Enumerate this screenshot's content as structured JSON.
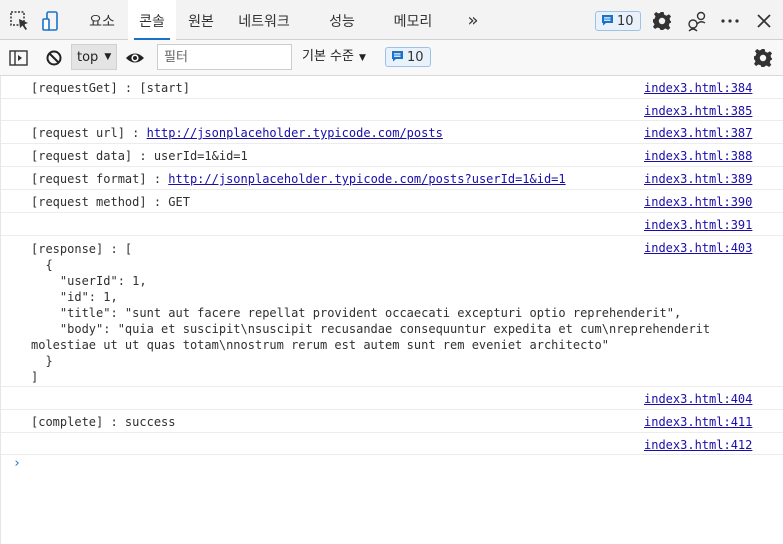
{
  "tabs": [
    {
      "label": "요소"
    },
    {
      "label": "콘솔"
    },
    {
      "label": "원본"
    },
    {
      "label": "네트워크"
    },
    {
      "label": "성능"
    },
    {
      "label": "메모리"
    }
  ],
  "active_tab": "콘솔",
  "more_tabs_label": "»",
  "message_count": "10",
  "toolbar": {
    "context": "top",
    "filter_placeholder": "필터",
    "levels_label": "기본 수준",
    "message_count": "10"
  },
  "logs": [
    {
      "message": "[requestGet] : [start]",
      "source": "index3.html:384"
    },
    {
      "message": "",
      "source": "index3.html:385"
    },
    {
      "message": "[request url] : ",
      "link": "http://jsonplaceholder.typicode.com/posts",
      "source": "index3.html:387"
    },
    {
      "message": "[request data] : userId=1&id=1",
      "source": "index3.html:388"
    },
    {
      "message": "[request format] : ",
      "link": "http://jsonplaceholder.typicode.com/posts?userId=1&id=1",
      "source": "index3.html:389"
    },
    {
      "message": "[request method] : GET",
      "source": "index3.html:390"
    },
    {
      "message": "",
      "source": "index3.html:391"
    },
    {
      "message": "[response] : [\n  {\n    \"userId\": 1,\n    \"id\": 1,\n    \"title\": \"sunt aut facere repellat provident occaecati excepturi optio reprehenderit\",\n    \"body\": \"quia et suscipit\\nsuscipit recusandae consequuntur expedita et cum\\nreprehenderit\nmolestiae ut ut quas totam\\nnostrum rerum est autem sunt rem eveniet architecto\"\n  }\n]",
      "source": "index3.html:403"
    },
    {
      "message": "",
      "source": "index3.html:404"
    },
    {
      "message": "[complete] : success",
      "source": "index3.html:411"
    },
    {
      "message": "",
      "source": "index3.html:412"
    }
  ],
  "prompt_symbol": "›",
  "colors": {
    "accent": "#1a73c9",
    "link": "#1a0dab",
    "badge_bg": "#e9f2fb"
  }
}
